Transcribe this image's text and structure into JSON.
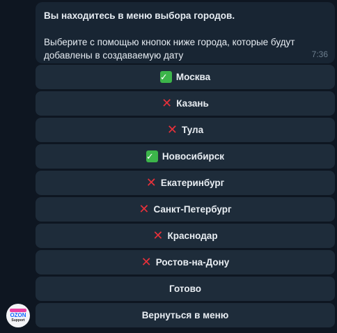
{
  "message": {
    "title": "Вы находитесь в меню выбора городов.",
    "body": "Выберите с помощью кнопок ниже города, которые будут добавлены в создаваемую дату",
    "time": "7:36"
  },
  "keyboard": [
    {
      "label": "Москва",
      "icon": "✅",
      "icon_name": "check-icon"
    },
    {
      "label": "Казань",
      "icon": "❌",
      "icon_name": "cross-icon"
    },
    {
      "label": "Тула",
      "icon": "❌",
      "icon_name": "cross-icon"
    },
    {
      "label": "Новосибирск",
      "icon": "✅",
      "icon_name": "check-icon"
    },
    {
      "label": "Екатеринбург",
      "icon": "❌",
      "icon_name": "cross-icon"
    },
    {
      "label": "Санкт-Петербург",
      "icon": "❌",
      "icon_name": "cross-icon"
    },
    {
      "label": "Краснодар",
      "icon": "❌",
      "icon_name": "cross-icon"
    },
    {
      "label": "Ростов-на-Дону",
      "icon": "❌",
      "icon_name": "cross-icon"
    },
    {
      "label": "Готово"
    },
    {
      "label": "Вернуться в меню"
    }
  ],
  "avatar": {
    "brand": "OZON",
    "sub": "Support"
  },
  "colors": {
    "background": "#0e1621",
    "message_bubble": "#182533",
    "button": "#1e2c3a",
    "check": "#3cb54a",
    "cross": "#e8313a"
  }
}
